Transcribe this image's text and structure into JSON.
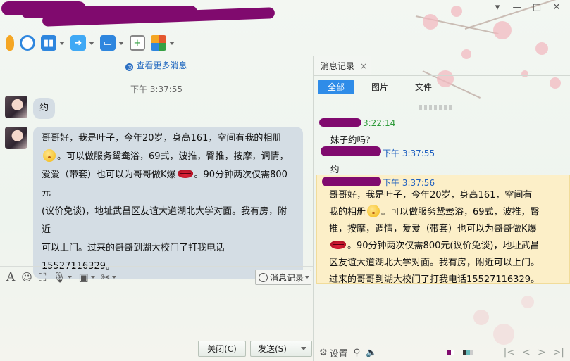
{
  "title_bar": {
    "redacted": true,
    "controls": [
      "▾",
      "—",
      "□",
      "✕"
    ]
  },
  "toolbar": {
    "items": [
      {
        "name": "microphone-icon",
        "color": "#f5a623",
        "has_dropdown": false
      },
      {
        "name": "camera-icon",
        "color": "#2e86de",
        "has_dropdown": false
      },
      {
        "name": "screen-share-icon",
        "color": "#2e86de",
        "has_dropdown": true
      },
      {
        "name": "file-transfer-icon",
        "color": "#3fa9f5",
        "has_dropdown": true
      },
      {
        "name": "remote-assist-icon",
        "color": "#2e86de",
        "has_dropdown": true
      },
      {
        "name": "add-chat-icon",
        "color": "#35a043",
        "has_dropdown": false
      },
      {
        "name": "apps-icon",
        "color": "#e4572e",
        "has_dropdown": true
      }
    ]
  },
  "chat": {
    "more_messages_link": "查看更多消息",
    "timestamp": "下午 3:37:55",
    "messages": [
      {
        "text": "约"
      },
      {
        "line1": "哥哥好，我是叶子，今年20岁，身高161，空间有我的相册",
        "line2": "。可以做服务鸳鸯浴，69式，波推，臀推，按摩，调情，",
        "line3a": "爱爱（带套）也可以为哥哥做K爆",
        "line3b": "。90分钟两次仅需800元",
        "line4": "(议价免谈)，地址武昌区友谊大道湖北大学对面。我有房，附近",
        "line5": "可以上门。过来的哥哥到湖大校门了打我电话15527116329。"
      }
    ]
  },
  "input_toolbar": {
    "items": [
      "font-icon",
      "emoji-icon",
      "screenshot-frame-icon",
      "voice-icon",
      "image-icon",
      "scissors-icon"
    ],
    "history_button": "消息记录"
  },
  "buttons": {
    "close": "关闭(C)",
    "send": "发送(S)"
  },
  "history": {
    "tab_label": "消息记录",
    "tab_close": "×",
    "filters": [
      "全部",
      "图片",
      "文件"
    ],
    "entries": [
      {
        "time": "3:22:14",
        "text": "妹子约吗？"
      },
      {
        "time": "下午 3:37:55",
        "text": "约"
      },
      {
        "time": "下午 3:37:56"
      }
    ],
    "long_message": {
      "line1": "哥哥好，我是叶子，今年20岁，身高161，空间有",
      "line2a": "我的相册",
      "line2b": "。可以做服务鸳鸯浴，69式，波推，臀",
      "line3": "推，按摩，调情，爱爱（带套）也可以为哥哥做K爆",
      "line4": "。90分钟两次仅需800元(议价免谈)，地址武昌",
      "line5": "区友谊大道湖北大学对面。我有房，附近可以上门。",
      "line6": "过来的哥哥到湖大校门了打我电话15527116329。"
    },
    "footer": {
      "settings": "设置",
      "nav": [
        "|<",
        "<",
        ">",
        ">|"
      ]
    }
  },
  "colors": {
    "accent": "#2f8ce8",
    "redaction": "#800a6e",
    "bubble": "#d4dde4",
    "highlight": "#fcefc8",
    "time_green": "#2e9a3a",
    "time_blue": "#1e5fbf"
  }
}
